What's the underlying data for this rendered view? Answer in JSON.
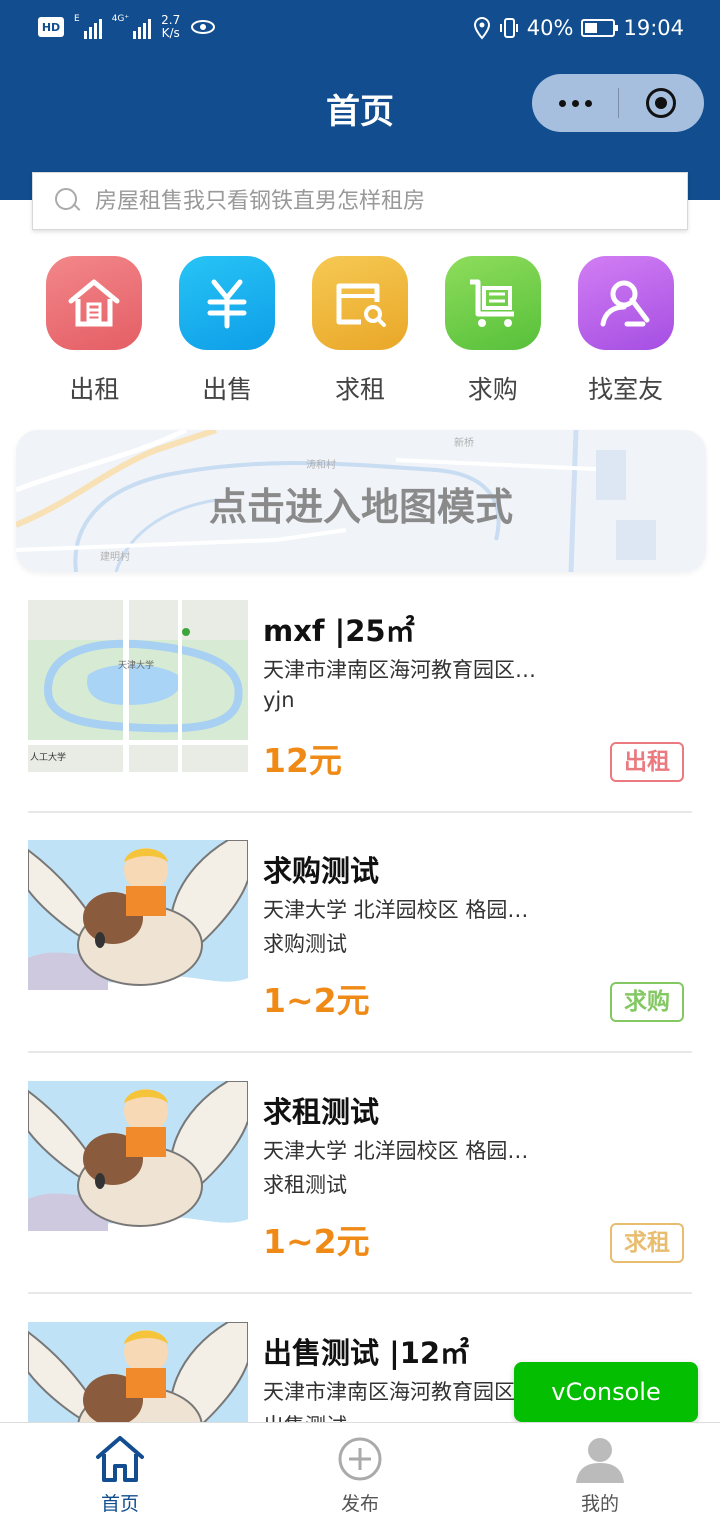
{
  "status_bar": {
    "hd": "HD",
    "sim1": "E",
    "sim2": "4G⁺",
    "speed": "2.7\nK/s",
    "battery": "40%",
    "time": "19:04"
  },
  "nav": {
    "title": "首页"
  },
  "search": {
    "placeholder": "房屋租售我只看钢铁直男怎样租房"
  },
  "categories": [
    {
      "label": "出租",
      "icon": "house-icon",
      "color": "#e8666c"
    },
    {
      "label": "出售",
      "icon": "yuan-icon",
      "color": "#12a9ee"
    },
    {
      "label": "求租",
      "icon": "search-card-icon",
      "color": "#eeb433"
    },
    {
      "label": "求购",
      "icon": "cart-icon",
      "color": "#6acb45"
    },
    {
      "label": "找室友",
      "icon": "users-icon",
      "color": "#b85ce9"
    }
  ],
  "map_banner": {
    "text": "点击进入地图模式",
    "labels": [
      "涛和村",
      "新桥",
      "建明村"
    ]
  },
  "listings": [
    {
      "title": "mxf |25㎡",
      "address": "天津市津南区海河教育园区…",
      "note": "yjn",
      "price": "12元",
      "tag": "出租",
      "tag_color": "#ea7a80",
      "thumb": "map-thumbnail"
    },
    {
      "title": "求购测试",
      "address": "天津大学 北洋园校区 格园…",
      "note": "求购测试",
      "price": "1~2元",
      "tag": "求购",
      "tag_color": "#84c864",
      "thumb": "bird-illustration"
    },
    {
      "title": "求租测试",
      "address": "天津大学 北洋园校区 格园…",
      "note": "求租测试",
      "price": "1~2元",
      "tag": "求租",
      "tag_color": "#e8bd6f",
      "thumb": "bird-illustration"
    },
    {
      "title": "出售测试 |12㎡",
      "address": "天津市津南区海河教育园区…",
      "note": "出售测试",
      "price": "",
      "tag": "",
      "thumb": "bird-illustration"
    }
  ],
  "vconsole": {
    "label": "vConsole"
  },
  "tabbar": [
    {
      "label": "首页",
      "icon": "home-icon",
      "active": true
    },
    {
      "label": "发布",
      "icon": "plus-circle-icon",
      "active": false
    },
    {
      "label": "我的",
      "icon": "person-icon",
      "active": false
    }
  ],
  "colors": {
    "primary": "#114d8f",
    "price": "#f08a16",
    "vconsole": "#04be02"
  }
}
